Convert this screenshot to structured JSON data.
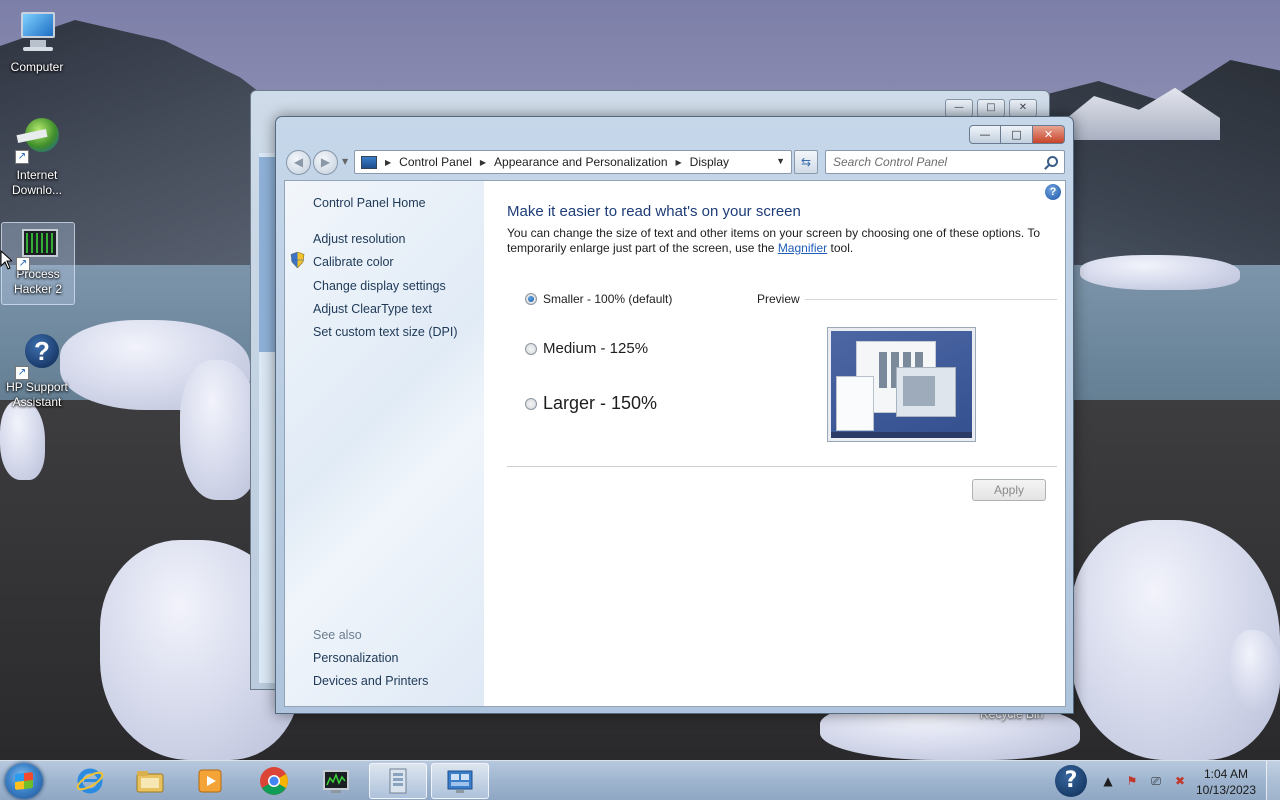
{
  "desktop": {
    "icons": [
      {
        "label": "Computer",
        "icon": "computer-icon"
      },
      {
        "label": "Internet\nDownlo...",
        "icon": "internet-download-manager-icon"
      },
      {
        "label": "Process\nHacker 2",
        "icon": "process-hacker-icon"
      },
      {
        "label": "HP Support\nAssistant",
        "icon": "hp-support-icon"
      }
    ],
    "recycle_bin_partial": "Recycle Bin"
  },
  "window": {
    "caption_buttons": {
      "minimize": "—",
      "maximize": "□",
      "close": "✕"
    },
    "breadcrumb": [
      "Control Panel",
      "Appearance and Personalization",
      "Display"
    ],
    "search_placeholder": "Search Control Panel",
    "left_pane": {
      "home": "Control Panel Home",
      "links": [
        "Adjust resolution",
        "Calibrate color",
        "Change display settings",
        "Adjust ClearType text",
        "Set custom text size (DPI)"
      ],
      "see_also_title": "See also",
      "see_also": [
        "Personalization",
        "Devices and Printers"
      ]
    },
    "main": {
      "heading": "Make it easier to read what's on your screen",
      "description_before_link": "You can change the size of text and other items on your screen by choosing one of these options. To temporarily enlarge just part of the screen, use the ",
      "link_text": "Magnifier",
      "description_after_link": " tool.",
      "options": [
        {
          "label": "Smaller - 100% (default)",
          "checked": true
        },
        {
          "label": "Medium - 125%",
          "checked": false
        },
        {
          "label": "Larger - 150%",
          "checked": false
        }
      ],
      "preview_label": "Preview",
      "apply_label": "Apply",
      "help": "?"
    }
  },
  "taskbar": {
    "pinned": [
      "internet-explorer-icon",
      "windows-explorer-icon",
      "media-player-icon",
      "chrome-icon",
      "process-hacker-icon",
      "window-icon",
      "control-panel-icon"
    ],
    "clock_time": "1:04 AM",
    "clock_date": "10/13/2023"
  }
}
